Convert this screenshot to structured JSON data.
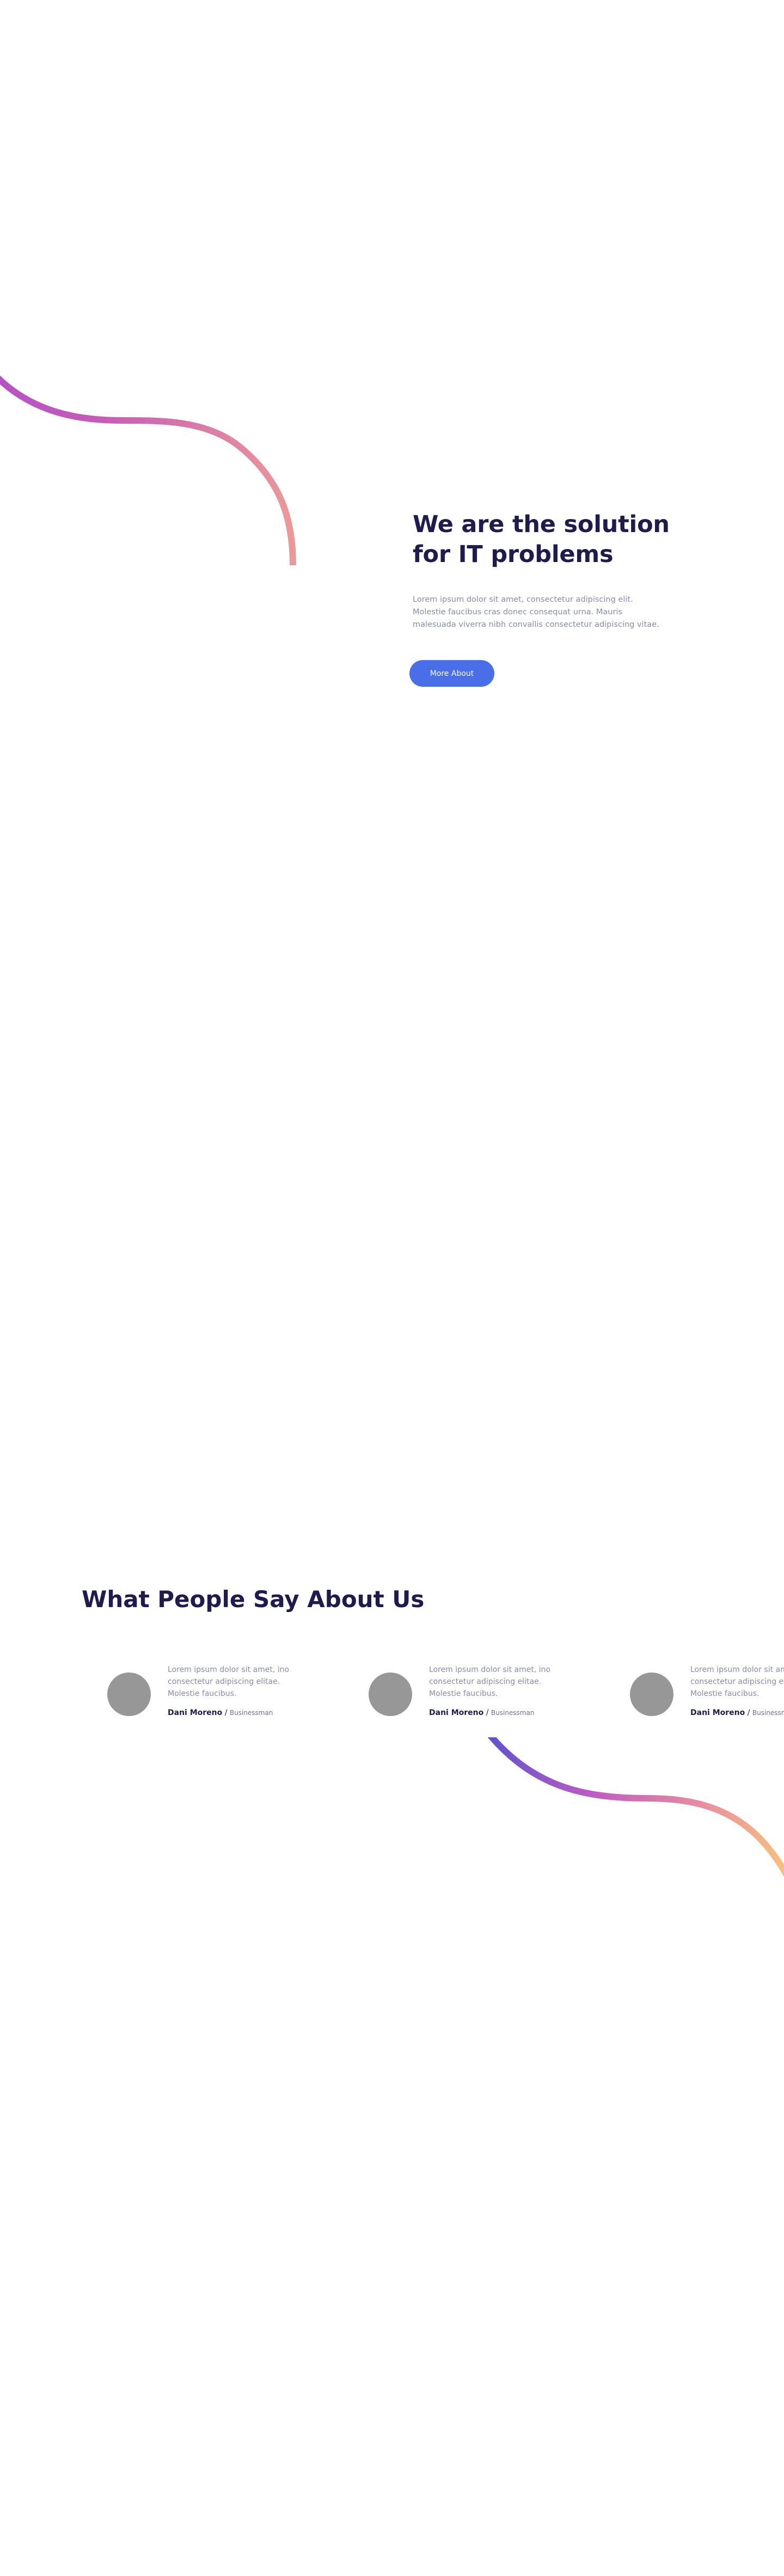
{
  "hero": {
    "title": "We are the solution for IT problems",
    "text": "Lorem ipsum dolor sit amet, consectetur adipiscing elit. Molestie faucibus cras donec consequat urna. Mauris malesuada viverra nibh convallis consectetur adipiscing vitae.",
    "button_label": "More About"
  },
  "testimonials": {
    "title": "What People Say About Us",
    "items": [
      {
        "quote": "Lorem ipsum dolor sit amet, ino consectetur adipiscing elitae. Molestie faucibus.",
        "name": "Dani Moreno",
        "separator": "/",
        "role": "Businessman"
      },
      {
        "quote": "Lorem ipsum dolor sit amet, ino consectetur adipiscing elitae. Molestie faucibus.",
        "name": "Dani Moreno",
        "separator": "/",
        "role": "Businessman"
      },
      {
        "quote": "Lorem ipsum dolor sit amet, ino consectetur adipiscing elitae. Molestie faucibus.",
        "name": "Dani Moreno",
        "separator": "/",
        "role": "Businessman"
      }
    ]
  },
  "colors": {
    "heading": "#1f1b4d",
    "body_text": "#8a8ca6",
    "button": "#4a6ee8",
    "avatar_placeholder": "#979797",
    "curve_gradient": [
      "#6a5ad0",
      "#c158c2",
      "#e58a9c",
      "#f7c27f"
    ]
  }
}
